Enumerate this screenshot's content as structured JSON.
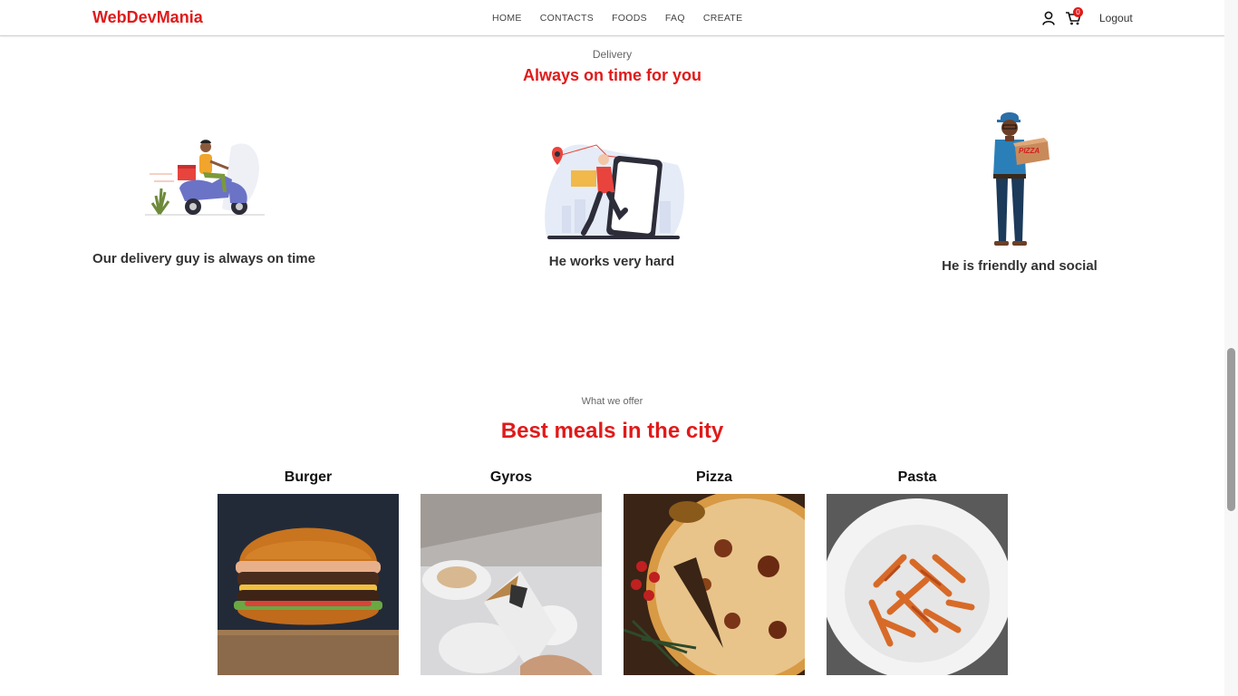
{
  "brand": "WebDevMania",
  "nav": {
    "links": [
      "HOME",
      "CONTACTS",
      "FOODS",
      "FAQ",
      "CREATE"
    ],
    "cart_count": "0",
    "logout_label": "Logout"
  },
  "delivery": {
    "kicker": "Delivery",
    "title": "Always on time for you",
    "items": [
      {
        "caption": "Our delivery guy is always on time",
        "icon": "scooter-delivery-illustration"
      },
      {
        "caption": "He works very hard",
        "icon": "phone-map-delivery-illustration"
      },
      {
        "caption": "He is friendly and social",
        "icon": "pizza-delivery-man-illustration",
        "box_text": "PIZZA"
      }
    ]
  },
  "offer": {
    "kicker": "What we offer",
    "title": "Best meals in the city",
    "meals": [
      {
        "name": "Burger",
        "icon": "burger-photo"
      },
      {
        "name": "Gyros",
        "icon": "gyros-photo"
      },
      {
        "name": "Pizza",
        "icon": "pizza-photo"
      },
      {
        "name": "Pasta",
        "icon": "pasta-photo"
      }
    ]
  },
  "colors": {
    "accent": "#e01a1a",
    "text": "#333333"
  }
}
